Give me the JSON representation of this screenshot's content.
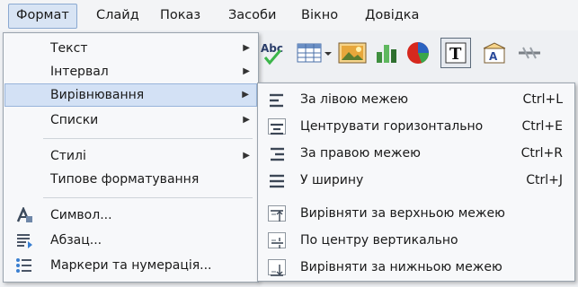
{
  "menubar": {
    "items": [
      {
        "text": "Формат"
      },
      {
        "text": "Слайд"
      },
      {
        "text": "Показ"
      },
      {
        "text": "Засоби"
      },
      {
        "text": "Вікно"
      },
      {
        "text": "Довідка"
      }
    ]
  },
  "toolbar": {
    "icons": [
      "spellcheck-icon",
      "table-icon",
      "image-icon",
      "chart-bar-icon",
      "pie-chart-icon",
      "text-box-icon",
      "fontwork-icon",
      "link-icon"
    ]
  },
  "format_menu": {
    "items": [
      {
        "label": "Текст",
        "submenu": true
      },
      {
        "label": "Інтервал",
        "submenu": true
      },
      {
        "label": "Вирівнювання",
        "submenu": true,
        "highlighted": true
      },
      {
        "label": "Списки",
        "submenu": true
      },
      {
        "label": "Стилі",
        "submenu": true
      },
      {
        "label": "Типове форматування",
        "submenu": false
      },
      {
        "label": "Символ...",
        "icon": "character-icon"
      },
      {
        "label": "Абзац...",
        "icon": "paragraph-icon"
      },
      {
        "label": "Маркери та нумерація...",
        "icon": "bullets-numbering-icon"
      }
    ]
  },
  "align_submenu": {
    "items": [
      {
        "label": "За лівою межею",
        "shortcut": "Ctrl+L"
      },
      {
        "label": "Центрувати горизонтально",
        "shortcut": "Ctrl+E"
      },
      {
        "label": "За правою межею",
        "shortcut": "Ctrl+R"
      },
      {
        "label": "У ширину",
        "shortcut": "Ctrl+J"
      },
      {
        "label": "Вирівняти за верхньою межею",
        "shortcut": ""
      },
      {
        "label": "По центру вертикально",
        "shortcut": ""
      },
      {
        "label": "Вирівняти за нижньою межею",
        "shortcut": ""
      }
    ]
  },
  "colors": {
    "highlight": "#d3e1f5",
    "highlight_border": "#98b4da",
    "menu_bg": "#f7f8fa"
  }
}
